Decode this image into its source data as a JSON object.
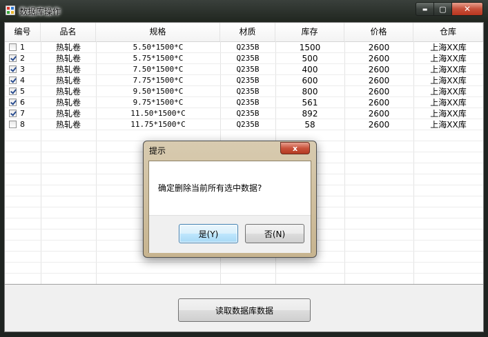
{
  "window": {
    "title": "数据库操作",
    "minimize_label": "▬",
    "maximize_label": "▢",
    "close_label": "✕"
  },
  "table": {
    "columns": [
      "编号",
      "品名",
      "规格",
      "材质",
      "库存",
      "价格",
      "仓库"
    ],
    "rows": [
      {
        "checked": false,
        "id": "1",
        "name": "热轧卷",
        "spec": "5.50*1500*C",
        "material": "Q235B",
        "stock": "1500",
        "price": "2600",
        "warehouse": "上海XX库"
      },
      {
        "checked": true,
        "id": "2",
        "name": "热轧卷",
        "spec": "5.75*1500*C",
        "material": "Q235B",
        "stock": "500",
        "price": "2600",
        "warehouse": "上海XX库"
      },
      {
        "checked": true,
        "id": "3",
        "name": "热轧卷",
        "spec": "7.50*1500*C",
        "material": "Q235B",
        "stock": "400",
        "price": "2600",
        "warehouse": "上海XX库"
      },
      {
        "checked": true,
        "id": "4",
        "name": "热轧卷",
        "spec": "7.75*1500*C",
        "material": "Q235B",
        "stock": "600",
        "price": "2600",
        "warehouse": "上海XX库"
      },
      {
        "checked": true,
        "id": "5",
        "name": "热轧卷",
        "spec": "9.50*1500*C",
        "material": "Q235B",
        "stock": "800",
        "price": "2600",
        "warehouse": "上海XX库"
      },
      {
        "checked": true,
        "id": "6",
        "name": "热轧卷",
        "spec": "9.75*1500*C",
        "material": "Q235B",
        "stock": "561",
        "price": "2600",
        "warehouse": "上海XX库"
      },
      {
        "checked": true,
        "id": "7",
        "name": "热轧卷",
        "spec": "11.50*1500*C",
        "material": "Q235B",
        "stock": "892",
        "price": "2600",
        "warehouse": "上海XX库"
      },
      {
        "checked": false,
        "id": "8",
        "name": "热轧卷",
        "spec": "11.75*1500*C",
        "material": "Q235B",
        "stock": "58",
        "price": "2600",
        "warehouse": "上海XX库"
      }
    ]
  },
  "read_button_label": "读取数据库数据",
  "dialog": {
    "title": "提示",
    "close_label": "x",
    "message": "确定删除当前所有选中数据?",
    "yes_label": "是(Y)",
    "no_label": "否(N)"
  },
  "colors": {
    "dialog_frame": "#c7b48f",
    "default_button": "#a7d9f5",
    "close_button": "#c9533c"
  }
}
